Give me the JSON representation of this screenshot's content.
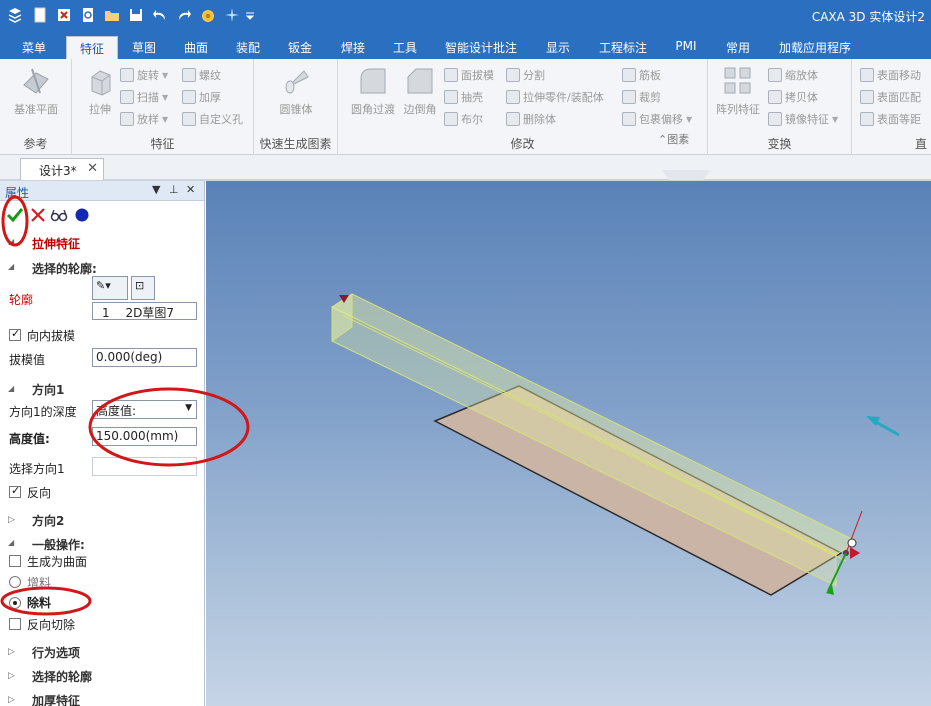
{
  "window": {
    "title": "CAXA 3D 实体设计2"
  },
  "quick_access": [
    "app-menu-icon",
    "new-file-icon",
    "close-file-icon",
    "print-preview-icon",
    "open-file-icon",
    "save-icon",
    "undo-icon",
    "redo-icon",
    "smart-icon",
    "sparkle-icon",
    "customize-dropdown-icon"
  ],
  "menu": {
    "tabs": [
      "菜单",
      "特征",
      "草图",
      "曲面",
      "装配",
      "钣金",
      "焊接",
      "工具",
      "智能设计批注",
      "显示",
      "工程标注",
      "PMI",
      "常用",
      "加载应用程序"
    ],
    "active_tab": "特征"
  },
  "ribbon": {
    "groups": {
      "reference": {
        "label": "参考",
        "base_plane": "基准平面"
      },
      "feature": {
        "label": "特征",
        "extrude": "拉伸",
        "revolve": "旋转",
        "sweep": "扫描",
        "loft": "放样",
        "helix": "螺纹",
        "thicken": "加厚",
        "custom_hole": "自定义孔"
      },
      "quick": {
        "label": "快速生成图素",
        "cone": "圆锥体"
      },
      "modify": {
        "label": "修改",
        "fillet": "圆角过渡",
        "chamfer": "边倒角",
        "face_draft": "面拔模",
        "shell": "抽壳",
        "boolean": "布尔",
        "split": "分割",
        "stretch_part": "拉伸零件/装配体",
        "delete_body": "删除体",
        "rib": "筋板",
        "trim": "裁剪",
        "wrap_offset": "包裹偏移",
        "overflow": "⌃图素"
      },
      "transform": {
        "label": "变换",
        "array": "阵列特征",
        "scale": "缩放体",
        "copy": "拷贝体",
        "mirror": "镜像特征"
      },
      "direct": {
        "label": "直",
        "move_face": "表面移动",
        "match_face": "表面匹配",
        "equal_face": "表面等距"
      }
    }
  },
  "document": {
    "tab_label": "设计3*"
  },
  "panel": {
    "header": "属性",
    "feature_title": "拉伸特征",
    "select_profile_section": "选择的轮廓:",
    "profile_label": "轮廓",
    "profile_list": {
      "index": "1",
      "name": "2D草图7"
    },
    "draft_inward": {
      "label": "向内拔模",
      "checked": true
    },
    "draft_value": {
      "label": "拔模值",
      "value": "0.000(deg)"
    },
    "direction1_section": "方向1",
    "direction1_depth": {
      "label": "方向1的深度",
      "value": "高度值:"
    },
    "height_value": {
      "label": "高度值:",
      "value": "150.000(mm)"
    },
    "select_direction1": {
      "label": "选择方向1",
      "value": ""
    },
    "reverse": {
      "label": "反向",
      "checked": true
    },
    "direction2_section": "方向2",
    "general_section": "一般操作:",
    "generate_surface": {
      "label": "生成为曲面",
      "checked": false
    },
    "add_material": {
      "label": "增料",
      "selected": false
    },
    "remove_material": {
      "label": "除料",
      "selected": true
    },
    "reverse_cut": {
      "label": "反向切除",
      "checked": false
    },
    "behavior_section": "行为选项",
    "selected_profile_section": "选择的轮廓",
    "thicken_section": "加厚特征"
  },
  "colors": {
    "title_bar": "#2a6fc0",
    "ribbon_bg": "#f3f5f8",
    "feature_title": "#c00000",
    "annotation": "#d01818",
    "confirm_check": "#1a9a1a",
    "sheet_fill": "#c9b4a6",
    "extrude_fill": "#e6eea2"
  }
}
